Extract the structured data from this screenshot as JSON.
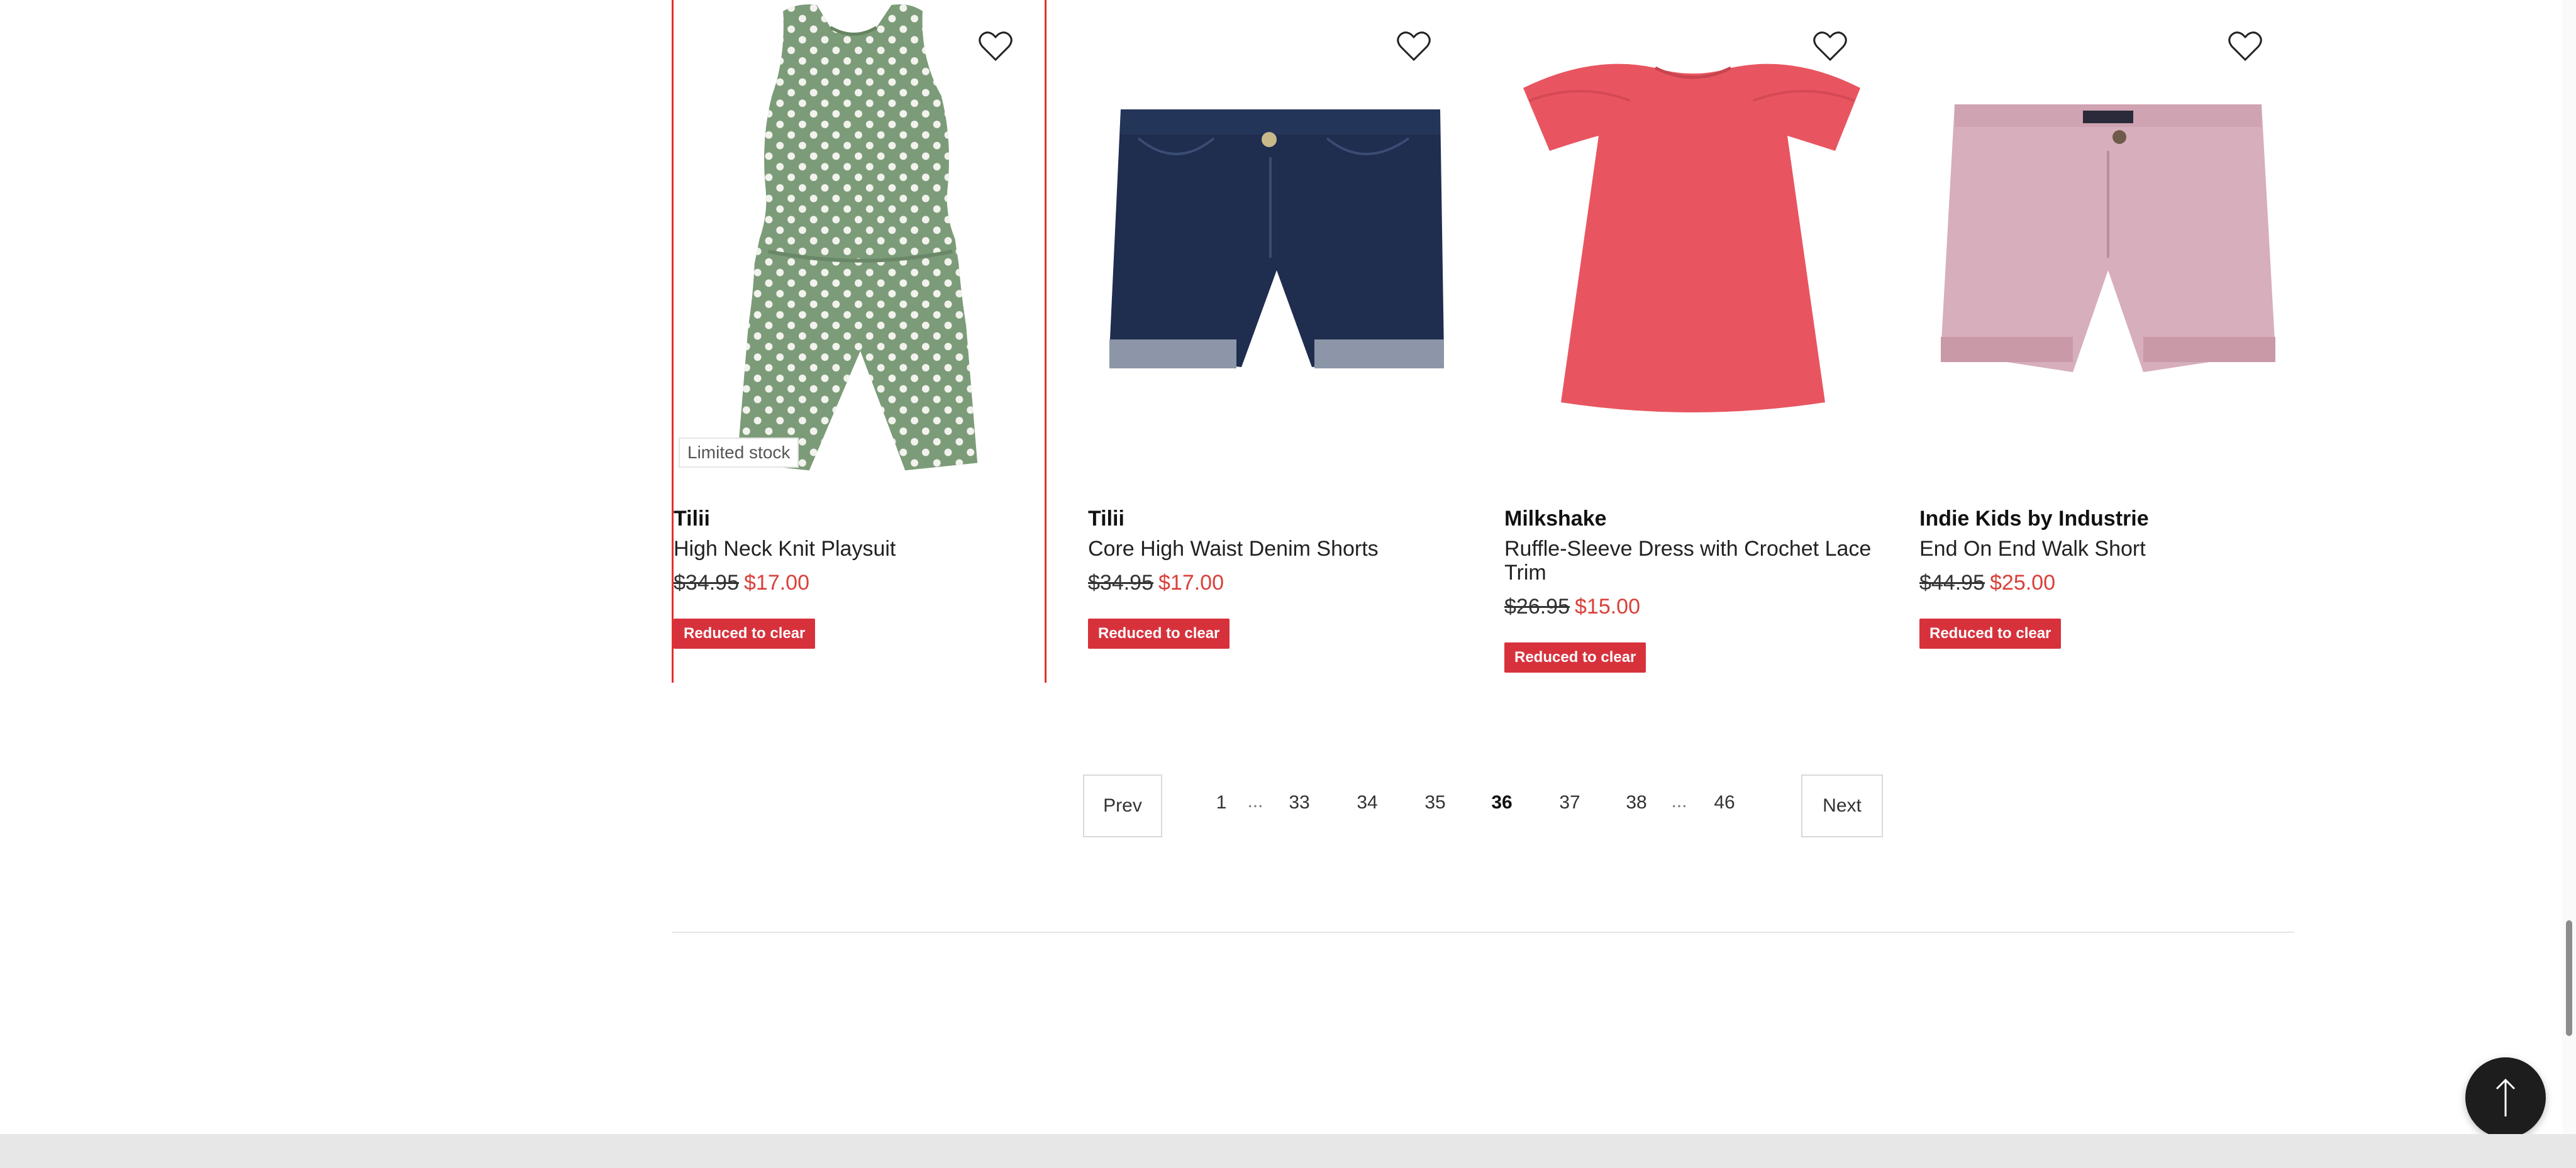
{
  "products": [
    {
      "brand": "Tilii",
      "name": "High Neck Knit Playsuit",
      "price_old": "$34.95",
      "price_new": "$17.00",
      "badge": "Limited stock",
      "tag": "Reduced to clear",
      "image": "green-polka-dot-playsuit",
      "image_color": "#7c9b78"
    },
    {
      "brand": "Tilii",
      "name": "Core High Waist Denim Shorts",
      "price_old": "$34.95",
      "price_new": "$17.00",
      "tag": "Reduced to clear",
      "image": "navy-denim-shorts",
      "image_color": "#1f2d4e"
    },
    {
      "brand": "Milkshake",
      "name": "Ruffle-Sleeve Dress with Crochet Lace Trim",
      "price_old": "$26.95",
      "price_new": "$15.00",
      "tag": "Reduced to clear",
      "image": "red-ruffle-sleeve-dress",
      "image_color": "#e85560"
    },
    {
      "brand": "Indie Kids by Industrie",
      "name": "End On End Walk Short",
      "price_old": "$44.95",
      "price_new": "$25.00",
      "tag": "Reduced to clear",
      "image": "pink-walk-shorts",
      "image_color": "#d7aebb"
    }
  ],
  "wishlist_icon": "heart-outline-icon",
  "pagination": {
    "prev": "Prev",
    "next": "Next",
    "pages": [
      "1",
      "...",
      "33",
      "34",
      "35",
      "36",
      "37",
      "38",
      "...",
      "46"
    ],
    "current": "36"
  },
  "scroll_top_icon": "arrow-up-icon",
  "colors": {
    "sale": "#d9403a",
    "tag_bg": "#d7323c",
    "selected_outline": "#e0312c"
  }
}
